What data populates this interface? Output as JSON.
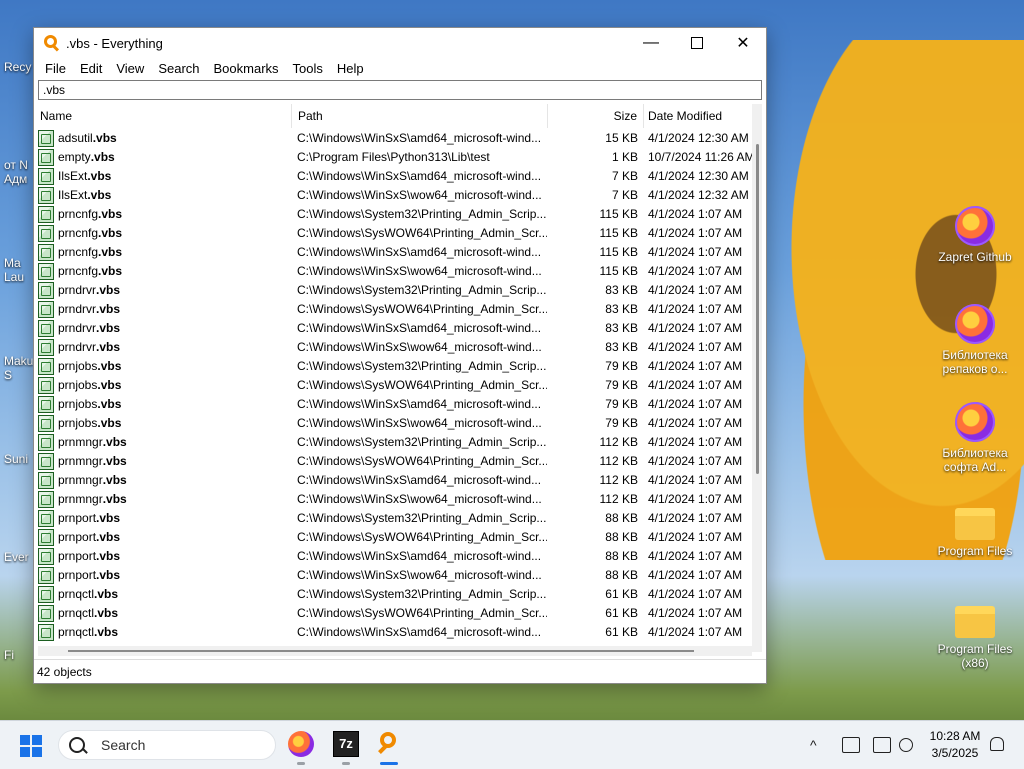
{
  "window": {
    "title": ".vbs - Everything",
    "controls": {
      "minimize": "—",
      "maximize": "",
      "close": "✕"
    }
  },
  "menu": [
    "File",
    "Edit",
    "View",
    "Search",
    "Bookmarks",
    "Tools",
    "Help"
  ],
  "search": {
    "value": ".vbs"
  },
  "columns": {
    "name": "Name",
    "path": "Path",
    "size": "Size",
    "date": "Date Modified"
  },
  "files": [
    {
      "name": "adsutil",
      "ext": ".vbs",
      "path": "C:\\Windows\\WinSxS\\amd64_microsoft-wind...",
      "size": "15 KB",
      "date": "4/1/2024 12:30 AM"
    },
    {
      "name": "empty",
      "ext": ".vbs",
      "path": "C:\\Program Files\\Python313\\Lib\\test",
      "size": "1 KB",
      "date": "10/7/2024 11:26 AM"
    },
    {
      "name": "IlsExt",
      "ext": ".vbs",
      "path": "C:\\Windows\\WinSxS\\amd64_microsoft-wind...",
      "size": "7 KB",
      "date": "4/1/2024 12:30 AM"
    },
    {
      "name": "IlsExt",
      "ext": ".vbs",
      "path": "C:\\Windows\\WinSxS\\wow64_microsoft-wind...",
      "size": "7 KB",
      "date": "4/1/2024 12:32 AM"
    },
    {
      "name": "prncnfg",
      "ext": ".vbs",
      "path": "C:\\Windows\\System32\\Printing_Admin_Scrip...",
      "size": "115 KB",
      "date": "4/1/2024 1:07 AM"
    },
    {
      "name": "prncnfg",
      "ext": ".vbs",
      "path": "C:\\Windows\\SysWOW64\\Printing_Admin_Scr...",
      "size": "115 KB",
      "date": "4/1/2024 1:07 AM"
    },
    {
      "name": "prncnfg",
      "ext": ".vbs",
      "path": "C:\\Windows\\WinSxS\\amd64_microsoft-wind...",
      "size": "115 KB",
      "date": "4/1/2024 1:07 AM"
    },
    {
      "name": "prncnfg",
      "ext": ".vbs",
      "path": "C:\\Windows\\WinSxS\\wow64_microsoft-wind...",
      "size": "115 KB",
      "date": "4/1/2024 1:07 AM"
    },
    {
      "name": "prndrvr",
      "ext": ".vbs",
      "path": "C:\\Windows\\System32\\Printing_Admin_Scrip...",
      "size": "83 KB",
      "date": "4/1/2024 1:07 AM"
    },
    {
      "name": "prndrvr",
      "ext": ".vbs",
      "path": "C:\\Windows\\SysWOW64\\Printing_Admin_Scr...",
      "size": "83 KB",
      "date": "4/1/2024 1:07 AM"
    },
    {
      "name": "prndrvr",
      "ext": ".vbs",
      "path": "C:\\Windows\\WinSxS\\amd64_microsoft-wind...",
      "size": "83 KB",
      "date": "4/1/2024 1:07 AM"
    },
    {
      "name": "prndrvr",
      "ext": ".vbs",
      "path": "C:\\Windows\\WinSxS\\wow64_microsoft-wind...",
      "size": "83 KB",
      "date": "4/1/2024 1:07 AM"
    },
    {
      "name": "prnjobs",
      "ext": ".vbs",
      "path": "C:\\Windows\\System32\\Printing_Admin_Scrip...",
      "size": "79 KB",
      "date": "4/1/2024 1:07 AM"
    },
    {
      "name": "prnjobs",
      "ext": ".vbs",
      "path": "C:\\Windows\\SysWOW64\\Printing_Admin_Scr...",
      "size": "79 KB",
      "date": "4/1/2024 1:07 AM"
    },
    {
      "name": "prnjobs",
      "ext": ".vbs",
      "path": "C:\\Windows\\WinSxS\\amd64_microsoft-wind...",
      "size": "79 KB",
      "date": "4/1/2024 1:07 AM"
    },
    {
      "name": "prnjobs",
      "ext": ".vbs",
      "path": "C:\\Windows\\WinSxS\\wow64_microsoft-wind...",
      "size": "79 KB",
      "date": "4/1/2024 1:07 AM"
    },
    {
      "name": "prnmngr",
      "ext": ".vbs",
      "path": "C:\\Windows\\System32\\Printing_Admin_Scrip...",
      "size": "112 KB",
      "date": "4/1/2024 1:07 AM"
    },
    {
      "name": "prnmngr",
      "ext": ".vbs",
      "path": "C:\\Windows\\SysWOW64\\Printing_Admin_Scr...",
      "size": "112 KB",
      "date": "4/1/2024 1:07 AM"
    },
    {
      "name": "prnmngr",
      "ext": ".vbs",
      "path": "C:\\Windows\\WinSxS\\amd64_microsoft-wind...",
      "size": "112 KB",
      "date": "4/1/2024 1:07 AM"
    },
    {
      "name": "prnmngr",
      "ext": ".vbs",
      "path": "C:\\Windows\\WinSxS\\wow64_microsoft-wind...",
      "size": "112 KB",
      "date": "4/1/2024 1:07 AM"
    },
    {
      "name": "prnport",
      "ext": ".vbs",
      "path": "C:\\Windows\\System32\\Printing_Admin_Scrip...",
      "size": "88 KB",
      "date": "4/1/2024 1:07 AM"
    },
    {
      "name": "prnport",
      "ext": ".vbs",
      "path": "C:\\Windows\\SysWOW64\\Printing_Admin_Scr...",
      "size": "88 KB",
      "date": "4/1/2024 1:07 AM"
    },
    {
      "name": "prnport",
      "ext": ".vbs",
      "path": "C:\\Windows\\WinSxS\\amd64_microsoft-wind...",
      "size": "88 KB",
      "date": "4/1/2024 1:07 AM"
    },
    {
      "name": "prnport",
      "ext": ".vbs",
      "path": "C:\\Windows\\WinSxS\\wow64_microsoft-wind...",
      "size": "88 KB",
      "date": "4/1/2024 1:07 AM"
    },
    {
      "name": "prnqctl",
      "ext": ".vbs",
      "path": "C:\\Windows\\System32\\Printing_Admin_Scrip...",
      "size": "61 KB",
      "date": "4/1/2024 1:07 AM"
    },
    {
      "name": "prnqctl",
      "ext": ".vbs",
      "path": "C:\\Windows\\SysWOW64\\Printing_Admin_Scr...",
      "size": "61 KB",
      "date": "4/1/2024 1:07 AM"
    },
    {
      "name": "prnqctl",
      "ext": ".vbs",
      "path": "C:\\Windows\\WinSxS\\amd64_microsoft-wind...",
      "size": "61 KB",
      "date": "4/1/2024 1:07 AM"
    }
  ],
  "status": "42 objects",
  "desktop": {
    "right_icons": [
      {
        "label": "Zapret Github",
        "icon": "firefox-shortcut-icon"
      },
      {
        "label": "Библиотека репаков о...",
        "icon": "firefox-shortcut-icon"
      },
      {
        "label": "Библиотека софта Ad...",
        "icon": "firefox-shortcut-icon"
      },
      {
        "label": "Program Files",
        "icon": "folder-icon"
      },
      {
        "label": "Program Files (x86)",
        "icon": "folder-icon"
      }
    ],
    "left_labels": [
      "Recy",
      "от N",
      "Адм",
      "Ma",
      "Lau",
      "Maku",
      "S",
      "Suni",
      "Ever",
      "Fi"
    ]
  },
  "taskbar": {
    "search_label": "Search",
    "apps": [
      {
        "name": "Firefox",
        "icon": "firefox-icon"
      },
      {
        "name": "7-Zip",
        "icon": "7zip-icon",
        "label": "7z"
      },
      {
        "name": "Everything",
        "icon": "everything-icon"
      }
    ],
    "time": "10:28 AM",
    "date": "3/5/2025"
  }
}
